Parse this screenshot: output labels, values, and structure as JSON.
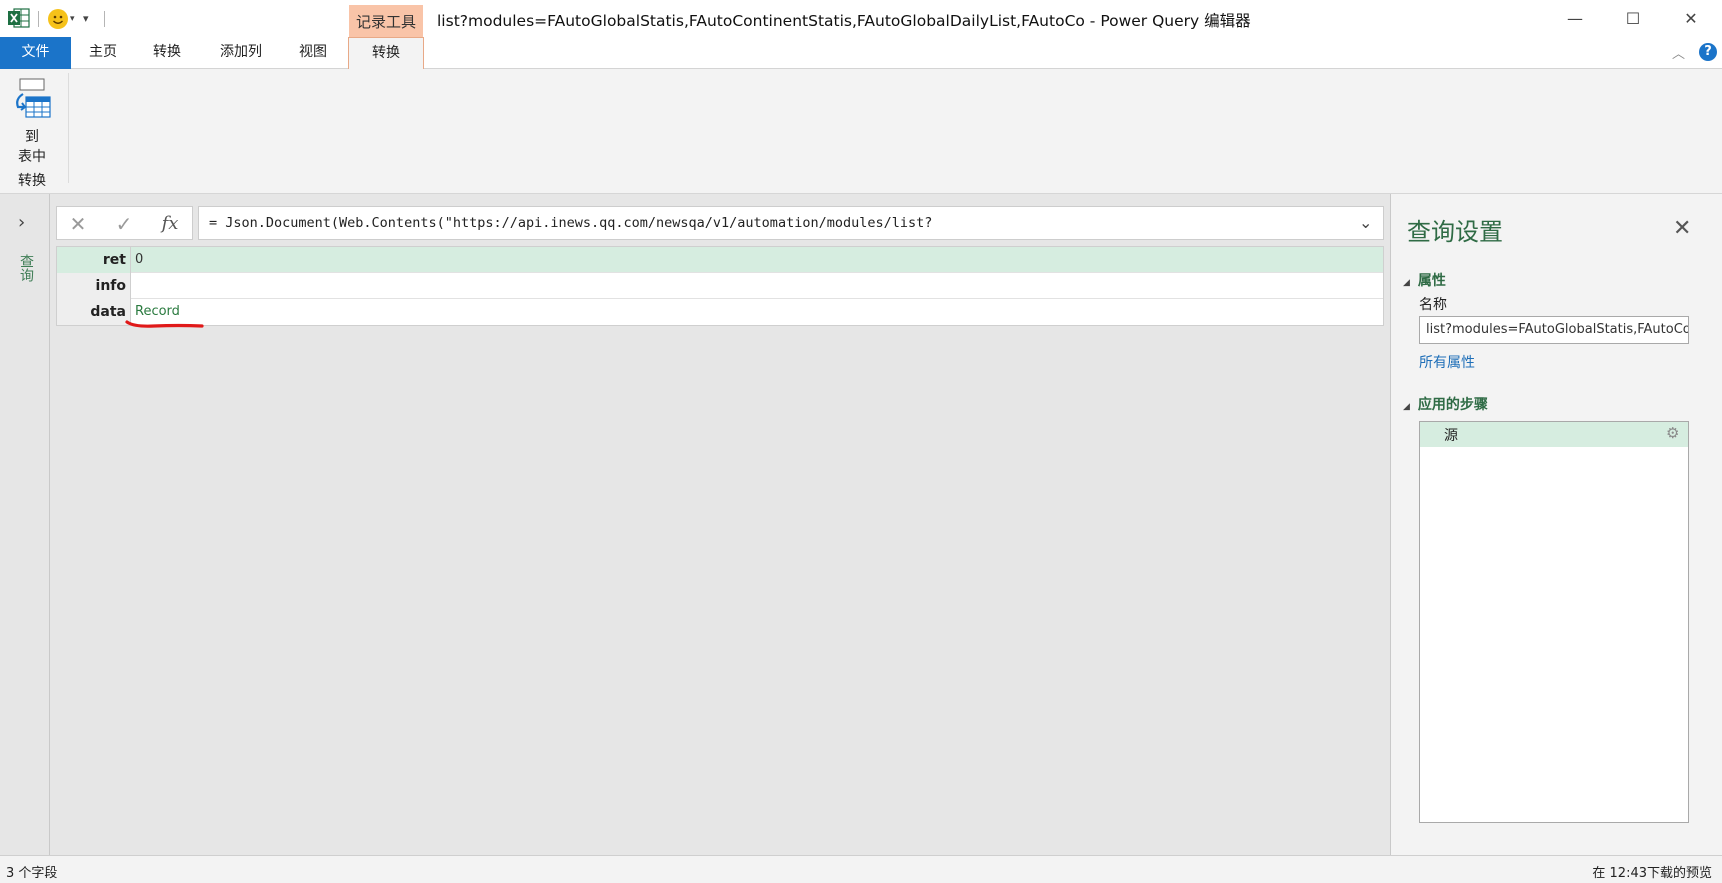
{
  "title_bar": {
    "context_tab": "记录工具",
    "window_title": "list?modules=FAutoGlobalStatis,FAutoContinentStatis,FAutoGlobalDailyList,FAutoCo - Power Query 编辑器",
    "qa_more": "▾",
    "minimize": "—",
    "maximize": "☐",
    "close": "✕"
  },
  "tabs": {
    "file": "文件",
    "home": "主页",
    "transform": "转换",
    "add_column": "添加列",
    "view": "视图",
    "record_transform": "转换"
  },
  "ribbon": {
    "to_table_line1": "到",
    "to_table_line2": "表中",
    "group_label": "转换",
    "collapse": "︿",
    "help": "?"
  },
  "left_pane": {
    "expand": "›",
    "label": "查询"
  },
  "formula_bar": {
    "cancel": "✕",
    "commit": "✓",
    "fx": "fx",
    "formula": "= Json.Document(Web.Contents(\"https://api.inews.qq.com/newsqa/v1/automation/modules/list?",
    "expand": "⌄"
  },
  "record": {
    "rows": [
      {
        "key": "ret",
        "value": "0"
      },
      {
        "key": "info",
        "value": ""
      },
      {
        "key": "data",
        "value": "Record"
      }
    ]
  },
  "query_settings": {
    "title": "查询设置",
    "close": "✕",
    "properties_header": "属性",
    "name_label": "名称",
    "name_value": "list?modules=FAutoGlobalStatis,FAutoContinentStatis",
    "all_properties": "所有属性",
    "steps_header": "应用的步骤",
    "steps": [
      {
        "label": "源"
      }
    ],
    "step_gear": "⚙"
  },
  "status": {
    "left": "3 个字段",
    "right": "在 12:43下载的预览"
  },
  "colors": {
    "accent_blue": "#1b74c9",
    "context_orange": "#f9c4a8",
    "selection_green": "#d6ede0",
    "header_green": "#2f6b45",
    "underline_red": "#e01919"
  },
  "icons": {
    "app": "excel-icon",
    "smile": "smiley-icon",
    "to_table": "record-to-table-icon",
    "settings_gear": "gear-icon"
  }
}
